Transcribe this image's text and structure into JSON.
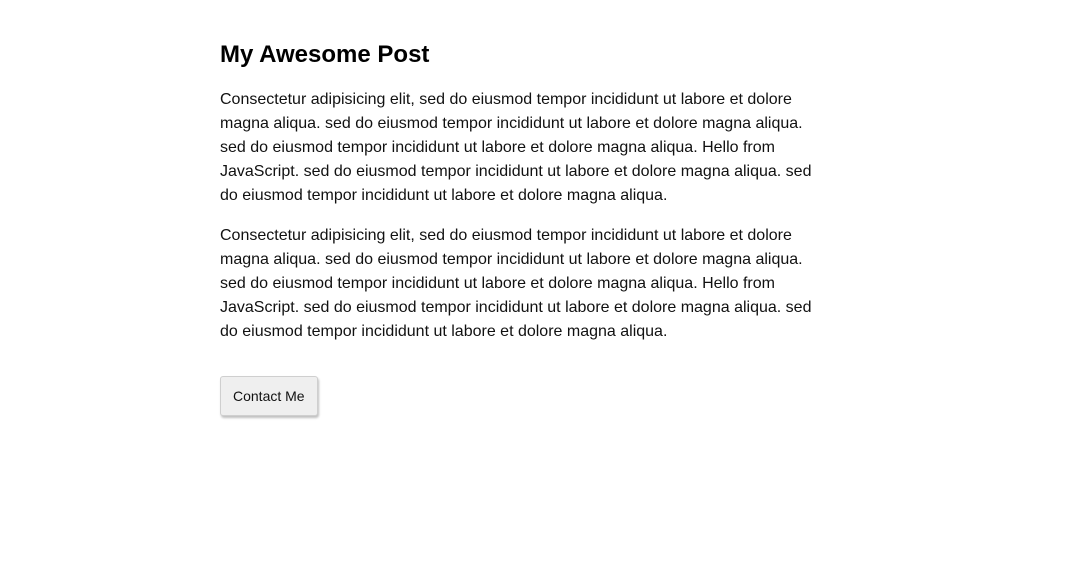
{
  "post": {
    "title": "My Awesome Post",
    "paragraphs": [
      "Consectetur adipisicing elit, sed do eiusmod tempor incididunt ut labore et dolore magna aliqua. sed do eiusmod tempor incididunt ut labore et dolore magna aliqua. sed do eiusmod tempor incididunt ut labore et dolore magna aliqua. Hello from JavaScript. sed do eiusmod tempor incididunt ut labore et dolore magna aliqua. sed do eiusmod tempor incididunt ut labore et dolore magna aliqua.",
      "Consectetur adipisicing elit, sed do eiusmod tempor incididunt ut labore et dolore magna aliqua. sed do eiusmod tempor incididunt ut labore et dolore magna aliqua. sed do eiusmod tempor incididunt ut labore et dolore magna aliqua. Hello from JavaScript. sed do eiusmod tempor incididunt ut labore et dolore magna aliqua. sed do eiusmod tempor incididunt ut labore et dolore magna aliqua."
    ],
    "contact_button_label": "Contact Me"
  }
}
